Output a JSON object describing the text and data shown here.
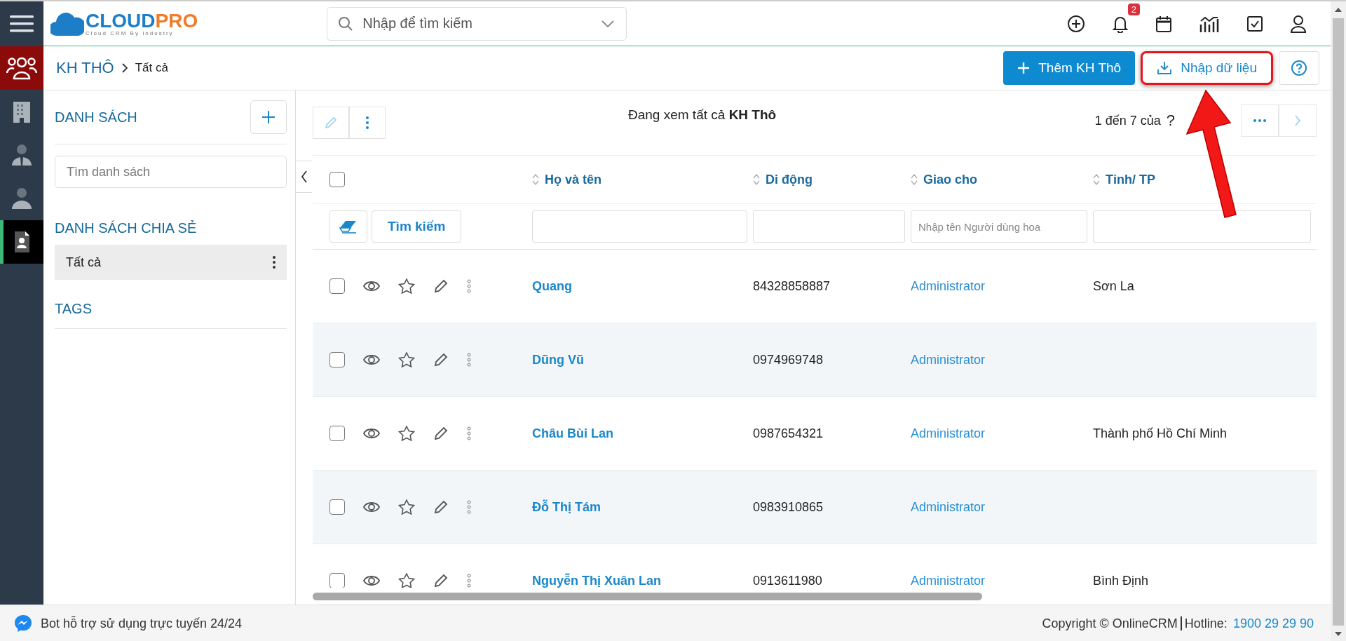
{
  "header": {
    "logo": {
      "brand_left": "CLOUD",
      "brand_right": "PRO",
      "tagline": "Cloud CRM By Industry"
    },
    "search": {
      "placeholder": "Nhập để tìm kiếm"
    },
    "notifications": {
      "count": "2"
    }
  },
  "rail": {
    "items": [
      {
        "selected": false,
        "kind": "building"
      },
      {
        "selected": false,
        "kind": "businessman"
      },
      {
        "selected": false,
        "kind": "person"
      },
      {
        "selected": true,
        "kind": "contact"
      }
    ]
  },
  "breadcrumb": {
    "module": "KH THÔ",
    "current": "Tất cả"
  },
  "actions": [
    {
      "kind": "add",
      "label": "Thêm KH Thô",
      "highlighted": false
    },
    {
      "kind": "import",
      "label": "Nhập dữ liệu",
      "highlighted": true
    },
    {
      "kind": "help",
      "highlighted": false
    }
  ],
  "list_panel": {
    "title": "DANH SÁCH",
    "search": {
      "placeholder": "Tìm danh sách"
    },
    "shared_title": "DANH SÁCH CHIA SẺ",
    "shared_items": [
      {
        "label": "Tất cả",
        "selected": true
      }
    ],
    "tags_title": "TAGS"
  },
  "table": {
    "viewing": "Đang xem tất cả **KH Thô**",
    "pagination": {
      "range": "1 đến 7 của",
      "total": "?"
    },
    "select_all_checked": false,
    "columns": [
      {
        "label": "Họ và tên"
      },
      {
        "label": "Di động"
      },
      {
        "label": "Giao cho",
        "filter_placeholder": "Nhập tên Người dùng hoa"
      },
      {
        "label": "Tỉnh/ TP"
      }
    ],
    "filter_button": "Tìm kiếm",
    "rows": [
      {
        "name": "Quang",
        "mobile": "84328858887",
        "assigned": "Administrator",
        "province": "Sơn La",
        "checked": false
      },
      {
        "name": "Dũng Vũ",
        "mobile": "0974969748",
        "assigned": "Administrator",
        "checked": false
      },
      {
        "name": "Châu Bùi Lan",
        "mobile": "0987654321",
        "assigned": "Administrator",
        "province": "Thành phố Hồ Chí Minh",
        "checked": false
      },
      {
        "name": "Đỗ Thị Tám",
        "mobile": "0983910865",
        "assigned": "Administrator",
        "checked": false
      },
      {
        "name": "Nguyễn Thị Xuân Lan",
        "mobile": "0913611980",
        "assigned": "Administrator",
        "province": "Bình Định",
        "checked": false
      }
    ]
  },
  "footer": {
    "bot": "Bot hỗ trợ sử dụng trực tuyến 24/24",
    "copyright": "Copyright © OnlineCRM",
    "hotline_label": "Hotline:",
    "hotline": "1900 29 29 90"
  }
}
